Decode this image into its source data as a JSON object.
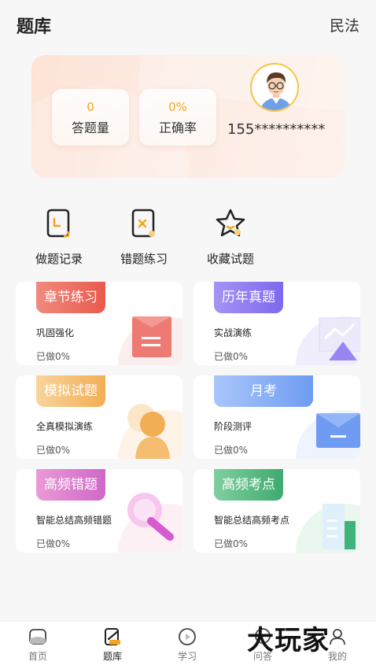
{
  "header": {
    "title": "题库",
    "subject": "民法"
  },
  "stats": {
    "answered_value": "0",
    "answered_label": "答题量",
    "accuracy_value": "0%",
    "accuracy_label": "正确率",
    "phone": "155**********"
  },
  "quick_actions": [
    {
      "label": "做题记录",
      "icon": "record-icon"
    },
    {
      "label": "错题练习",
      "icon": "wrong-answers-icon"
    },
    {
      "label": "收藏试题",
      "icon": "star-icon"
    }
  ],
  "cards": [
    {
      "tag": "章节练习",
      "desc": "巩固强化",
      "done": "已做0%",
      "color": "#ee6b5c"
    },
    {
      "tag": "历年真题",
      "desc": "实战演练",
      "done": "已做0%",
      "color": "#8f7cf0"
    },
    {
      "tag": "模拟试题",
      "desc": "全真模拟演练",
      "done": "已做0%",
      "color": "#f3b25e"
    },
    {
      "tag": "月考",
      "desc": "阶段测评",
      "done": "已做0%",
      "color": "#7ea9f5"
    },
    {
      "tag": "高频错题",
      "desc": "智能总结高频错题",
      "done": "已做0%",
      "color": "#e07fc9"
    },
    {
      "tag": "高频考点",
      "desc": "智能总结高频考点",
      "done": "已做0%",
      "color": "#3fb37a"
    }
  ],
  "bottom_nav": [
    {
      "label": "首页",
      "icon": "home-icon"
    },
    {
      "label": "题库",
      "icon": "question-bank-icon",
      "active": true
    },
    {
      "label": "学习",
      "icon": "play-icon"
    },
    {
      "label": "问答",
      "icon": "qa-icon"
    },
    {
      "label": "我的",
      "icon": "profile-icon"
    }
  ],
  "watermark": "大玩家"
}
